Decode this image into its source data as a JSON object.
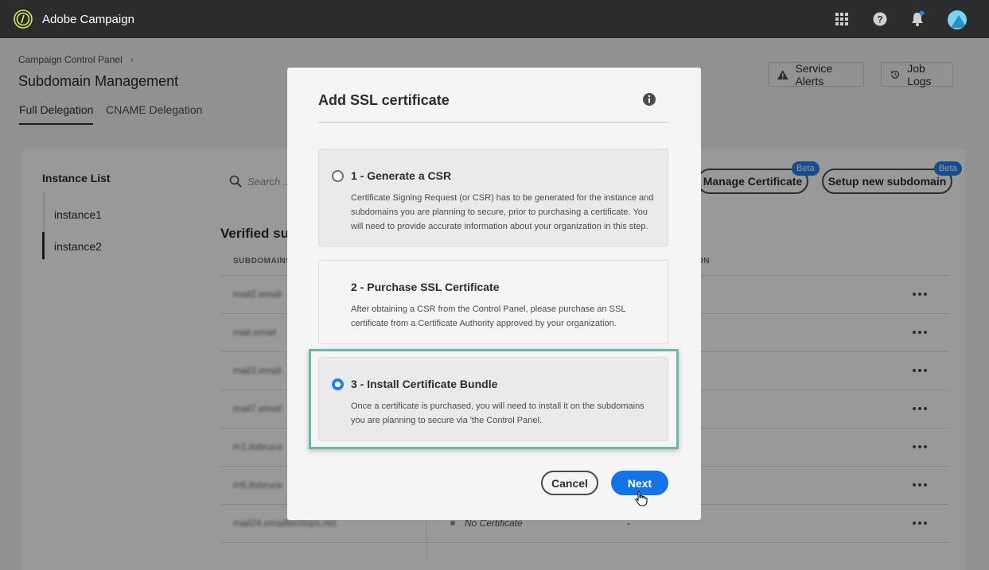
{
  "app": {
    "name": "Adobe Campaign",
    "logo_icon": "adobe-campaign-logo-icon"
  },
  "topbar_icons": [
    "apps-grid-icon",
    "help-icon",
    "notifications-bell-icon",
    "user-avatar"
  ],
  "page": {
    "breadcrumb": "Campaign Control Panel",
    "title": "Subdomain Management",
    "tabs": [
      "Full Delegation",
      "CNAME Delegation"
    ],
    "active_tab": "Full Delegation"
  },
  "header_buttons": {
    "service_alerts": "Service Alerts",
    "job_logs": "Job Logs"
  },
  "instances": {
    "heading": "Instance List",
    "items": [
      "instance1",
      "instance2"
    ],
    "selected": "instance2"
  },
  "search": {
    "placeholder": "Search ..."
  },
  "actions": {
    "manage_certificate": "Manage Certificate",
    "setup_subdomain": "Setup new subdomain",
    "beta": "Beta"
  },
  "table": {
    "section_title": "Verified sub",
    "col_subdomains": "SUBDOMAINS",
    "col_partial": "ON",
    "rows": [
      {
        "name": "mail2.email"
      },
      {
        "name": "mail.email"
      },
      {
        "name": "mail3.email"
      },
      {
        "name": "mail7.email"
      },
      {
        "name": "m1.itsbruce"
      },
      {
        "name": "m5.itsbruce"
      },
      {
        "name": "mail24.emailtechops.net",
        "certificate": "No Certificate",
        "extra": "-"
      }
    ]
  },
  "modal": {
    "title": "Add SSL certificate",
    "options": [
      {
        "title": "1 - Generate a CSR",
        "description": "Certificate Signing Request (or CSR) has to be generated for the instance and subdomains you are planning to secure, prior to purchasing a certificate. You will need to provide accurate information about your organization in this step.",
        "selected": false
      },
      {
        "title": "2 - Purchase SSL Certificate",
        "description": "After obtaining a CSR from the Control Panel, please purchase an SSL certificate from a Certificate Authority approved by your organization.",
        "selected": false
      },
      {
        "title": "3 - Install Certificate Bundle",
        "description": "Once a certificate is purchased, you will need to install it on the subdomains you are planning to secure via 'the Control Panel.",
        "selected": true
      }
    ],
    "cancel_label": "Cancel",
    "next_label": "Next"
  },
  "colors": {
    "topbar": "#2c2c2c",
    "accent_blue": "#1473e6",
    "highlight_border": "#6cb7aa",
    "avatar": "#7fd2f1"
  }
}
